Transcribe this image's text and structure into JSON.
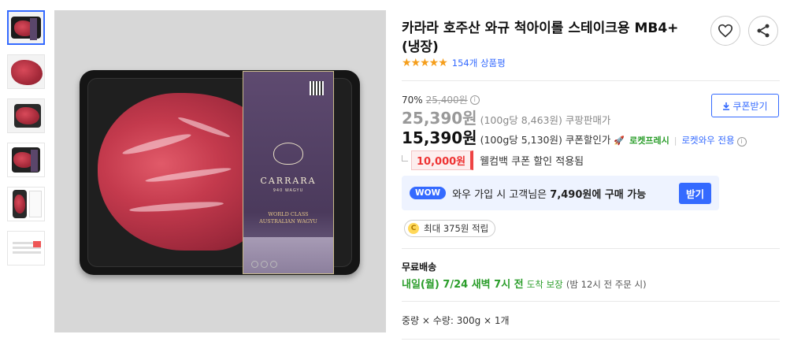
{
  "product": {
    "title": "카라라 호주산 와규 척아이롤 스테이크용 MB4+ (냉장)",
    "rating_stars": "★★★★★",
    "review_count": "154개 상품평"
  },
  "package": {
    "brand": "CARRARA",
    "brand_sub": "940 WAGYU",
    "label_line1": "WORLD CLASS",
    "label_line2": "AUSTRALIAN WAGYU"
  },
  "pricing": {
    "discount_rate": "70%",
    "original_price": "25,400원",
    "info_icon": "i",
    "sale_price": "25,390원",
    "sale_unit_price": "(100g당 8,463원)",
    "sale_tag": "쿠팡판매가",
    "coupon_price": "15,390원",
    "coupon_unit_price": "(100g당 5,130원)",
    "coupon_tag": "쿠폰할인가",
    "rocket_badge": "로켓프레시",
    "separator": "|",
    "wow_only": "로켓와우 전용",
    "coupon_button": "쿠폰받기"
  },
  "welcome_coupon": {
    "amount": "10,000원",
    "text": "웰컴백 쿠폰 할인 적용됨"
  },
  "wow": {
    "badge": "WOW",
    "text_prefix": "와우 가입 시 고객님은",
    "price_text": "7,490원에 구매 가능",
    "button": "받기"
  },
  "cash": {
    "coin_label": "C",
    "text": "최대 375원 적립"
  },
  "shipping": {
    "label": "무료배송",
    "date": "내일(월) 7/24 새벽 7시 전",
    "guarantee": "도착 보장",
    "note": "(밤 12시 전 주문 시)"
  },
  "option": {
    "text": "중량 × 수량: 300g × 1개"
  },
  "colors": {
    "accent_blue": "#346aff",
    "rocket_green": "#2a9d2a",
    "coupon_red": "#e33333",
    "star_orange": "#f59e1b"
  }
}
